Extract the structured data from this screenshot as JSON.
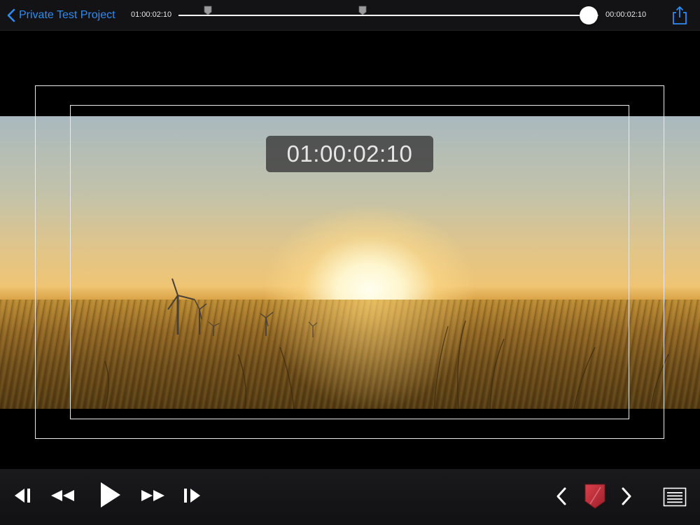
{
  "header": {
    "back_label": "Private Test Project",
    "timecode_start": "01:00:02:10",
    "timecode_end": "00:00:02:10"
  },
  "scrubber": {
    "position_fraction": 0.977,
    "marker_fractions": [
      0.07,
      0.438
    ]
  },
  "viewer": {
    "timecode_overlay": "01:00:02:10"
  },
  "icons": {
    "back": "chevron-left-icon",
    "share": "share-icon",
    "step_back": "step-back-icon",
    "rewind": "rewind-icon",
    "play": "play-icon",
    "fast_forward": "fast-forward-icon",
    "step_forward": "step-forward-icon",
    "prev_marker": "chevron-left-icon",
    "marker_flag": "marker-flag-icon",
    "next_marker": "chevron-right-icon",
    "list": "list-icon"
  },
  "colors": {
    "accent": "#2f8cf5",
    "marker_flag": "#c9313c",
    "bar_background": "#131315"
  }
}
